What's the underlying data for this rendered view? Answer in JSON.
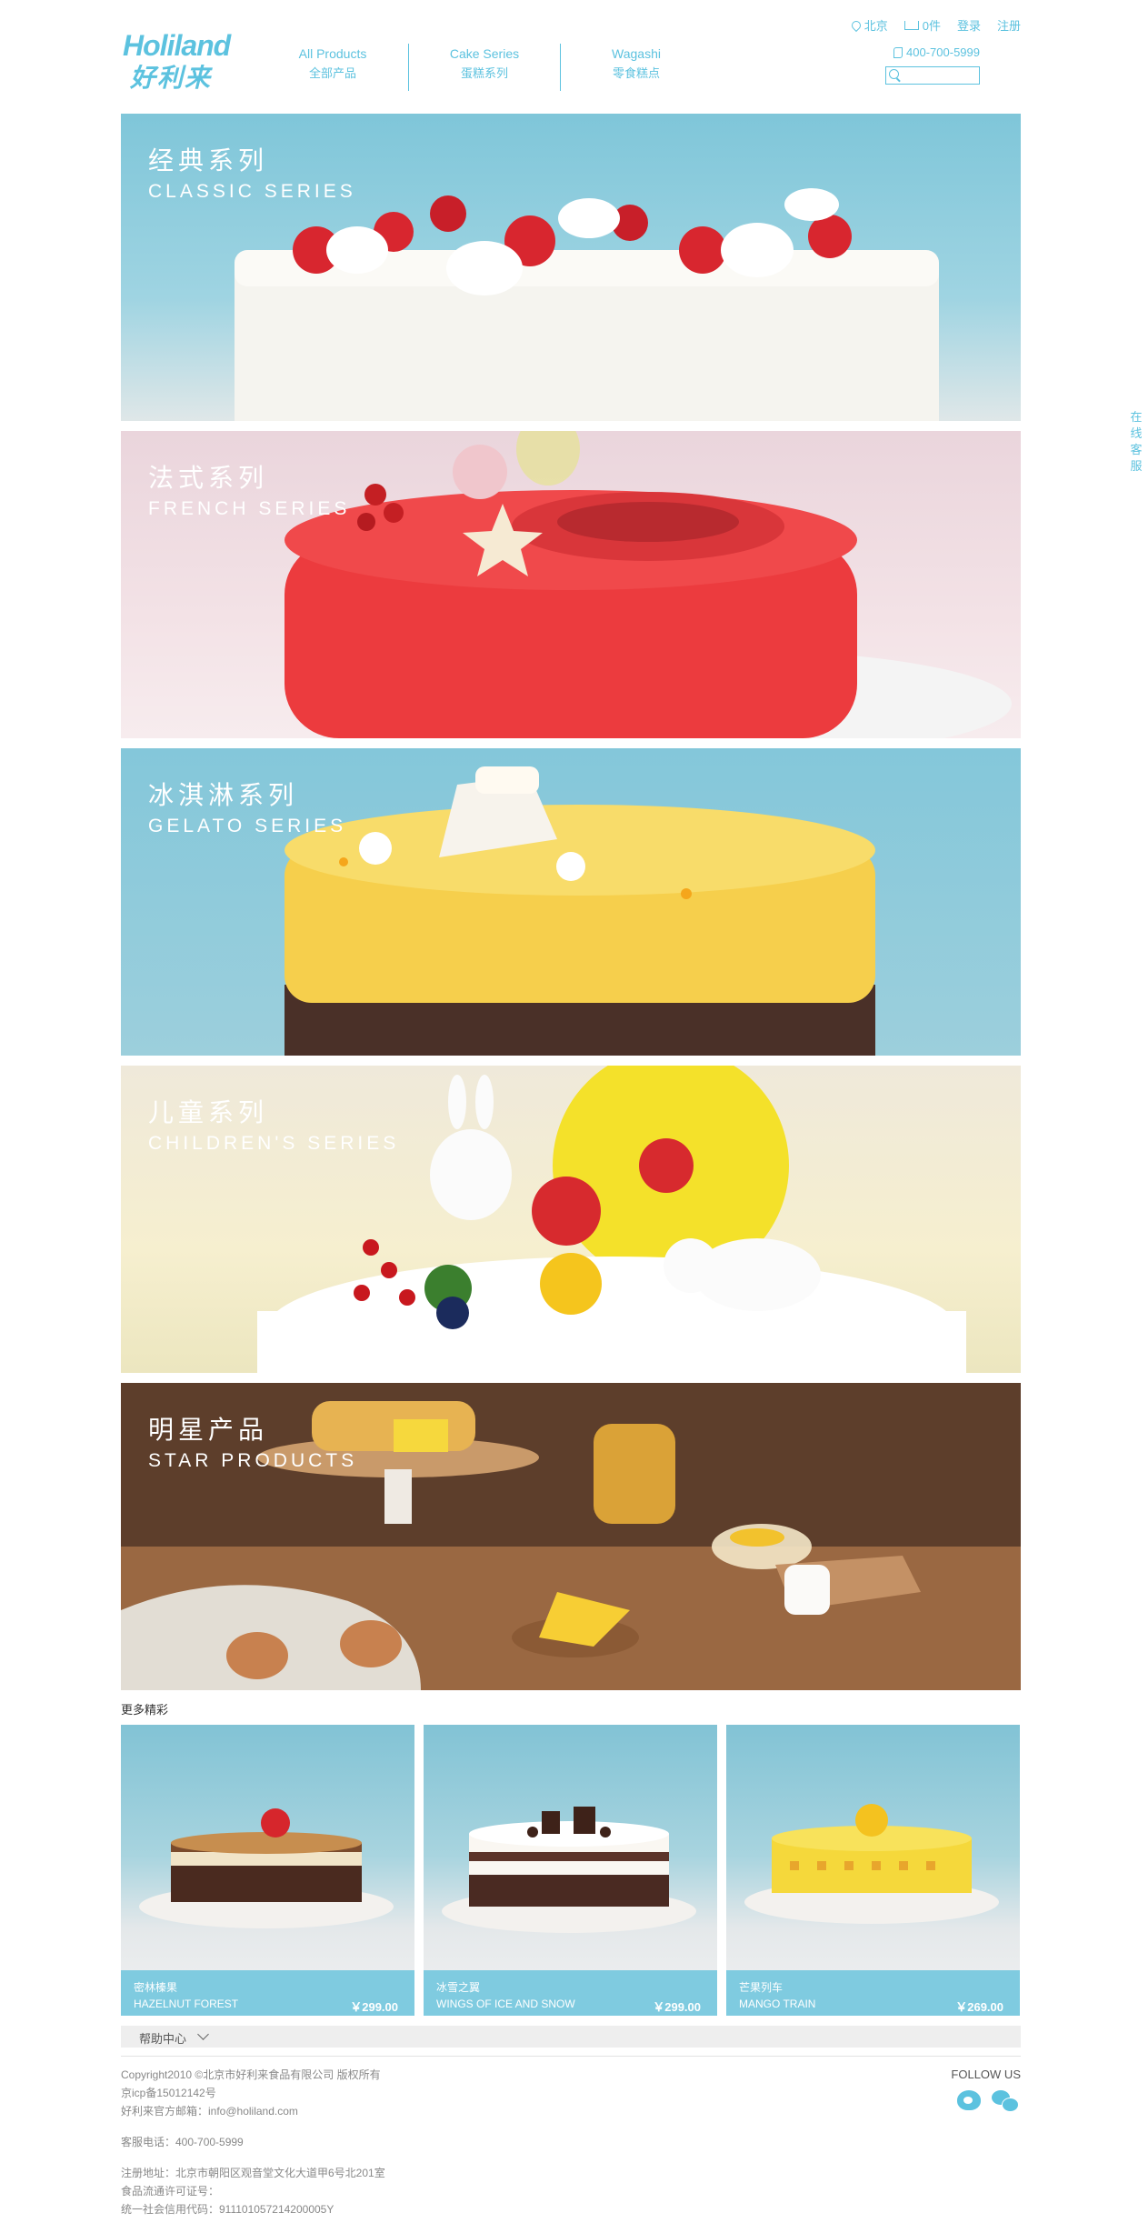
{
  "header": {
    "logo_en": "Holiland",
    "logo_cn": "好利来",
    "nav": [
      {
        "en": "All Products",
        "cn": "全部产品"
      },
      {
        "en": "Cake Series",
        "cn": "蛋糕系列"
      },
      {
        "en": "Wagashi",
        "cn": "零食糕点"
      }
    ],
    "top_links": {
      "city": "北京",
      "cart": "0件",
      "login": "登录",
      "register": "注册"
    },
    "phone": "400-700-5999",
    "search": {
      "placeholder": "",
      "value": ""
    }
  },
  "side_service": "在线客服",
  "banners": [
    {
      "cn": "经典系列",
      "en": "CLASSIC SERIES"
    },
    {
      "cn": "法式系列",
      "en": "FRENCH SERIES"
    },
    {
      "cn": "冰淇淋系列",
      "en": "GELATO SERIES"
    },
    {
      "cn": "儿童系列",
      "en": "CHILDREN'S SERIES"
    },
    {
      "cn": "明星产品",
      "en": "STAR PRODUCTS"
    }
  ],
  "more": {
    "title": "更多精彩",
    "products": [
      {
        "cn": "密林榛果",
        "en": "HAZELNUT FOREST",
        "price": "￥299.00"
      },
      {
        "cn": "冰雪之翼",
        "en": "WINGS OF ICE AND SNOW",
        "price": "￥299.00"
      },
      {
        "cn": "芒果列车",
        "en": "MANGO TRAIN",
        "price": "￥269.00"
      }
    ]
  },
  "footer": {
    "help": "帮助中心",
    "copyright": "Copyright2010 ©北京市好利来食品有限公司 版权所有",
    "icp": "京icp备15012142号",
    "email": "好利来官方邮箱：info@holiland.com",
    "service_phone": "客服电话：400-700-5999",
    "address": "注册地址：北京市朝阳区观音堂文化大道甲6号北201室",
    "license": "食品流通许可证号：",
    "credit": "统一社会信用代码：911101057214200005Y",
    "follow": "FOLLOW US"
  },
  "colors": {
    "accent": "#5cc2df",
    "product_bar": "#7fcbe0"
  }
}
